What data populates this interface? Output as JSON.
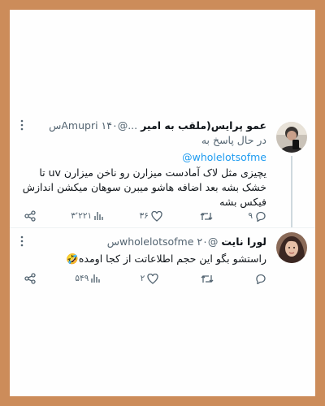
{
  "tweet1": {
    "name": "عمو پرایس(ملقب به امیر",
    "handle": "...@Amupri",
    "time": "۱۴۰س",
    "reply_prefix": "در حال پاسخ به",
    "reply_to": "@wholelotsofme",
    "text": "یچیزی مثل لاک آمادست میزارن رو ناخن میزارن uv تا خشک بشه بعد اضافه هاشو میبرن سوهان میکشن اندازش فیکس بشه",
    "stats": {
      "views": "۳٬۲۲۱",
      "likes": "۳۶",
      "retweets": "",
      "replies": "۹"
    }
  },
  "tweet2": {
    "name": "لورا نایت",
    "handle": "@wholelotsofme",
    "time": "۲۰س",
    "text": "راستشو بگو این حجم اطلاعاتت از کجا اومده🤣",
    "stats": {
      "views": "۵۴۹",
      "likes": "۲",
      "retweets": "",
      "replies": ""
    }
  },
  "icons": {
    "more": "more-dots-icon",
    "share": "share-icon",
    "views": "views-bar-chart-icon",
    "like": "heart-icon",
    "retweet": "retweet-icon",
    "reply": "reply-bubble-icon"
  },
  "colors": {
    "frame": "#cc8c5a",
    "mention": "#1d9bf0",
    "muted": "#536471",
    "text": "#0f1419"
  }
}
